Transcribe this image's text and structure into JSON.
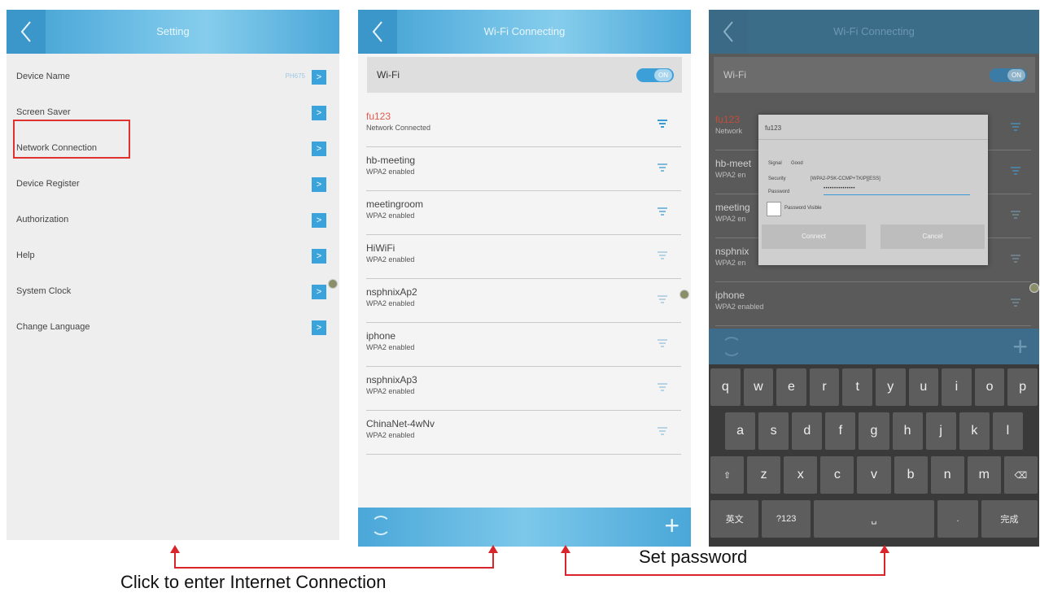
{
  "screen1": {
    "title": "Setting",
    "device_name_value": "PH675",
    "rows": [
      {
        "label": "Device Name"
      },
      {
        "label": "Screen Saver"
      },
      {
        "label": "Network Connection"
      },
      {
        "label": "Device Register"
      },
      {
        "label": "Authorization"
      },
      {
        "label": "Help"
      },
      {
        "label": "System Clock"
      },
      {
        "label": "Change Language"
      }
    ]
  },
  "screen2": {
    "title": "Wi-Fi Connecting",
    "wifi_label": "Wi-Fi",
    "toggle_text": "ON",
    "networks": [
      {
        "name": "fu123",
        "status": "Network Connected"
      },
      {
        "name": "hb-meeting",
        "status": "WPA2 enabled"
      },
      {
        "name": "meetingroom",
        "status": "WPA2 enabled"
      },
      {
        "name": "HiWiFi",
        "status": "WPA2 enabled"
      },
      {
        "name": "nsphnixAp2",
        "status": "WPA2 enabled"
      },
      {
        "name": "iphone",
        "status": "WPA2 enabled"
      },
      {
        "name": "nsphnixAp3",
        "status": "WPA2 enabled"
      },
      {
        "name": "ChinaNet-4wNv",
        "status": "WPA2 enabled"
      }
    ]
  },
  "screen3": {
    "title": "Wi-Fi Connecting",
    "wifi_label": "Wi-Fi",
    "toggle_text": "ON",
    "networks_partial": [
      {
        "name": "fu123",
        "status": "Network"
      },
      {
        "name": "hb-meet",
        "status": "WPA2 en"
      },
      {
        "name": "meeting",
        "status": "WPA2 en"
      },
      {
        "name": "nsphnix",
        "status": "WPA2 en"
      },
      {
        "name": "iphone",
        "status": "WPA2 enabled"
      }
    ],
    "dialog": {
      "title": "fu123",
      "signal_label": "Signal",
      "signal_value": "Good",
      "security_label": "Security",
      "security_value": "[WPA2-PSK-CCMP+TKIP][ESS]",
      "password_label": "Password",
      "password_value": "•••••••••••••••",
      "visible_label": "Password Visible",
      "connect_label": "Connect",
      "cancel_label": "Cancel"
    },
    "keyboard": {
      "row1": [
        "q",
        "w",
        "e",
        "r",
        "t",
        "y",
        "u",
        "i",
        "o",
        "p"
      ],
      "row2": [
        "a",
        "s",
        "d",
        "f",
        "g",
        "h",
        "j",
        "k",
        "l"
      ],
      "row3": [
        "⇧",
        "z",
        "x",
        "c",
        "v",
        "b",
        "n",
        "m",
        "⌫"
      ],
      "row4": [
        "英文",
        "?123",
        "␣",
        ".",
        "完成"
      ]
    }
  },
  "annotations": {
    "left_caption": "Click to enter Internet Connection",
    "right_caption": "Set password"
  },
  "colors": {
    "accent": "#3aa3dc",
    "highlight": "#e0322f",
    "connected": "#e05a4a"
  }
}
